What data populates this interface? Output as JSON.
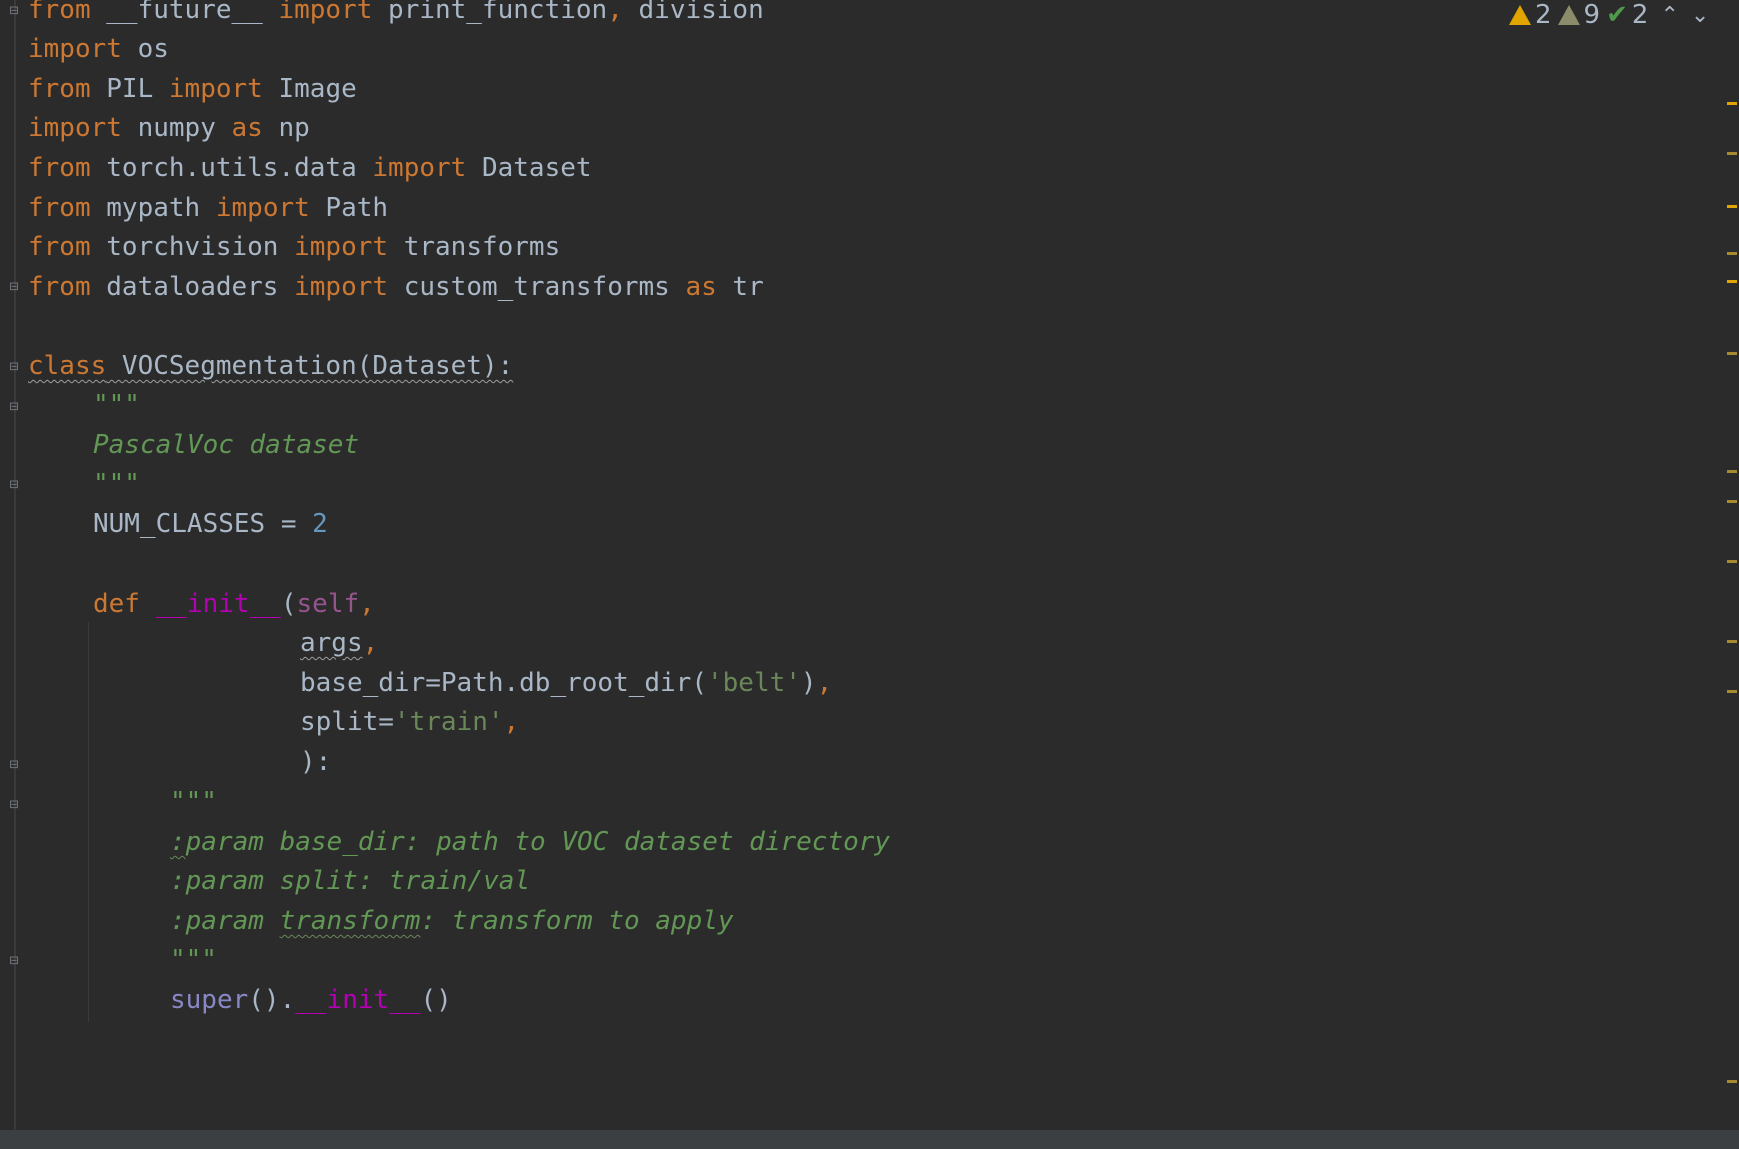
{
  "inspections": {
    "errors_count": "2",
    "warnings_count": "9",
    "typos_count": "2",
    "up_icon": "chevron-up-icon",
    "down_icon": "chevron-down-icon"
  },
  "code": {
    "l1": {
      "t1": "from",
      "t2": " __future__ ",
      "t3": "import",
      "t4": " print_function",
      "t5": ",",
      "t6": " division"
    },
    "l2": {
      "t1": "import",
      "t2": " os"
    },
    "l3": {
      "t1": "from",
      "t2": " PIL ",
      "t3": "import",
      "t4": " Image"
    },
    "l4": {
      "t1": "import",
      "t2": " numpy ",
      "t3": "as",
      "t4": " np"
    },
    "l5": {
      "t1": "from",
      "t2": " torch.utils.data ",
      "t3": "import",
      "t4": " Dataset"
    },
    "l6": {
      "t1": "from",
      "t2": " mypath ",
      "t3": "import",
      "t4": " Path"
    },
    "l7": {
      "t1": "from",
      "t2": " torchvision ",
      "t3": "import",
      "t4": " transforms"
    },
    "l8": {
      "t1": "from",
      "t2": " dataloaders ",
      "t3": "import",
      "t4": " custom_transforms ",
      "t5": "as",
      "t6": " tr"
    },
    "l9": {
      "t1": "class",
      "t2": " VOCSegmentation(Dataset):"
    },
    "l10": {
      "t1": "\"\"\""
    },
    "l11": {
      "t1": "PascalVoc dataset"
    },
    "l12": {
      "t1": "\"\"\""
    },
    "l13": {
      "t1": "NUM_CLASSES = ",
      "t2": "2"
    },
    "l14": {
      "t1": "def",
      "t2": " __init__",
      "t3": "(",
      "t4": "self",
      ",": ","
    },
    "l15": {
      "t1": "args",
      ",": ","
    },
    "l16": {
      "t1": "base_dir=Path.db_root_dir(",
      "t2": "'belt'",
      "t3": ")",
      ",": ","
    },
    "l17": {
      "t1": "split=",
      "t2": "'train'",
      ",": ","
    },
    "l18": {
      "t1": "):"
    },
    "l19": {
      "t1": "\"\"\""
    },
    "l20": {
      "t1": ":",
      "t2": "param base_dir: path to VOC dataset directory"
    },
    "l21": {
      "t1": ":param split: train/val"
    },
    "l22": {
      "t1": ":param ",
      "t2": "transform",
      "t3": ": transform to apply"
    },
    "l23": {
      "t1": "\"\"\""
    },
    "l24": {
      "t1": "super",
      "t2": "().",
      "t3": "__init__",
      "t4": "()"
    }
  }
}
